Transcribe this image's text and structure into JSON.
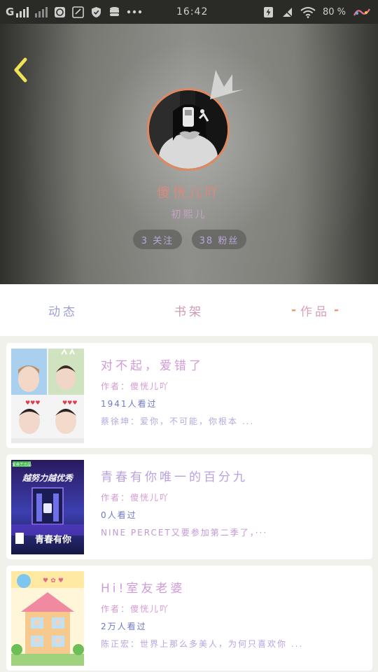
{
  "status_bar": {
    "carrier": "G",
    "time": "16:42",
    "battery": "80 %"
  },
  "profile": {
    "nickname": "傻恍儿吖",
    "signature": "初熙儿",
    "following": "3 关注",
    "followers": "38 粉丝"
  },
  "tabs": [
    {
      "label": "动态"
    },
    {
      "label": "书架"
    },
    {
      "label": "作品",
      "dash": "-",
      "active": true
    }
  ],
  "works": [
    {
      "title": "对不起，爱错了",
      "author": "作者：傻恍儿吖",
      "reads": "1941人看过",
      "excerpt": "蔡徐坤：爱你，不可能，你根本 ...",
      "title_color": "#d49ad8",
      "excerpt_color": "#b6a9e0"
    },
    {
      "title": "青春有你唯一的百分九",
      "author": "作者：傻恍儿吖",
      "reads": "0人看过",
      "excerpt": "NINE PERCET又要参加第二季了，···",
      "title_color": "#b8a0e2",
      "excerpt_color": "#c198d6",
      "cover_text": "青春有你",
      "cover_tagline": "越努力越优秀",
      "cover_badge": "爱奇艺出品"
    },
    {
      "title": "Hi!室友老婆",
      "author": "作者：傻恍儿吖",
      "reads": "2万人看过",
      "excerpt": "陈正宏：世界上那么多美人，为何只喜欢你 ...",
      "title_color": "#cf9ad8",
      "excerpt_color": "#b9a3e0"
    }
  ],
  "colors": {
    "accent_orange": "#ea9a68",
    "avatar_ring": "#e2875e"
  }
}
